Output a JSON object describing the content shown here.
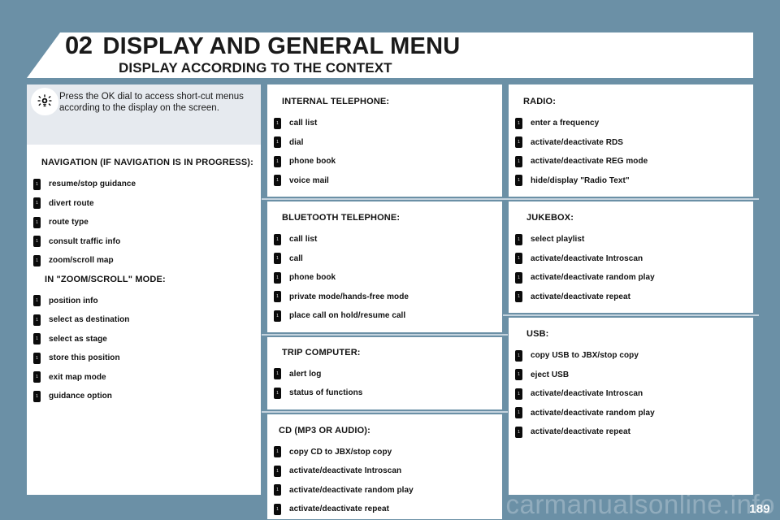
{
  "header": {
    "chapter_number": "02",
    "chapter_title": "DISPLAY AND GENERAL MENU",
    "subtitle": "DISPLAY ACCORDING TO THE CONTEXT"
  },
  "tip": {
    "icon": "lightbulb-icon",
    "text": "Press the OK dial to access short-cut menus according to the display on the screen."
  },
  "bullet_glyph": "1",
  "columns": {
    "left": [
      {
        "heading": "NAVIGATION (IF NAVIGATION IS IN PROGRESS):",
        "items": [
          "resume/stop guidance",
          "divert route",
          "route type",
          "consult traffic info",
          "zoom/scroll map"
        ]
      },
      {
        "heading": "IN \"ZOOM/SCROLL\" MODE:",
        "items": [
          "position info",
          "select as destination",
          "select as stage",
          "store this position",
          "exit map mode",
          "guidance option"
        ]
      }
    ],
    "middle": [
      {
        "heading": "INTERNAL TELEPHONE:",
        "items": [
          "call list",
          "dial",
          "phone book",
          "voice mail"
        ]
      },
      {
        "heading": "BLUETOOTH TELEPHONE:",
        "items": [
          "call list",
          "call",
          "phone book",
          "private mode/hands-free mode",
          "place call on hold/resume call"
        ]
      },
      {
        "heading": "TRIP COMPUTER:",
        "items": [
          "alert log",
          "status of functions"
        ]
      },
      {
        "heading": "CD (MP3 OR AUDIO):",
        "items": [
          "copy CD to JBX/stop copy",
          "activate/deactivate Introscan",
          "activate/deactivate random play",
          "activate/deactivate repeat"
        ]
      }
    ],
    "right": [
      {
        "heading": "RADIO:",
        "items": [
          "enter a frequency",
          "activate/deactivate RDS",
          "activate/deactivate REG mode",
          "hide/display \"Radio Text\""
        ]
      },
      {
        "heading": "JUKEBOX:",
        "items": [
          "select playlist",
          "activate/deactivate Introscan",
          "activate/deactivate random play",
          "activate/deactivate repeat"
        ]
      },
      {
        "heading": "USB:",
        "items": [
          "copy USB to JBX/stop copy",
          "eject USB",
          "activate/deactivate Introscan",
          "activate/deactivate random play",
          "activate/deactivate repeat"
        ]
      }
    ]
  },
  "footer": {
    "page_number": "189",
    "watermark": "carmanualsonline.info"
  },
  "colors": {
    "page_background": "#6b90a6",
    "panel_background": "#ffffff",
    "tip_background": "#e6eaef",
    "divider": "#c4d3de",
    "text": "#111111",
    "bullet": "#0b0b0b"
  }
}
